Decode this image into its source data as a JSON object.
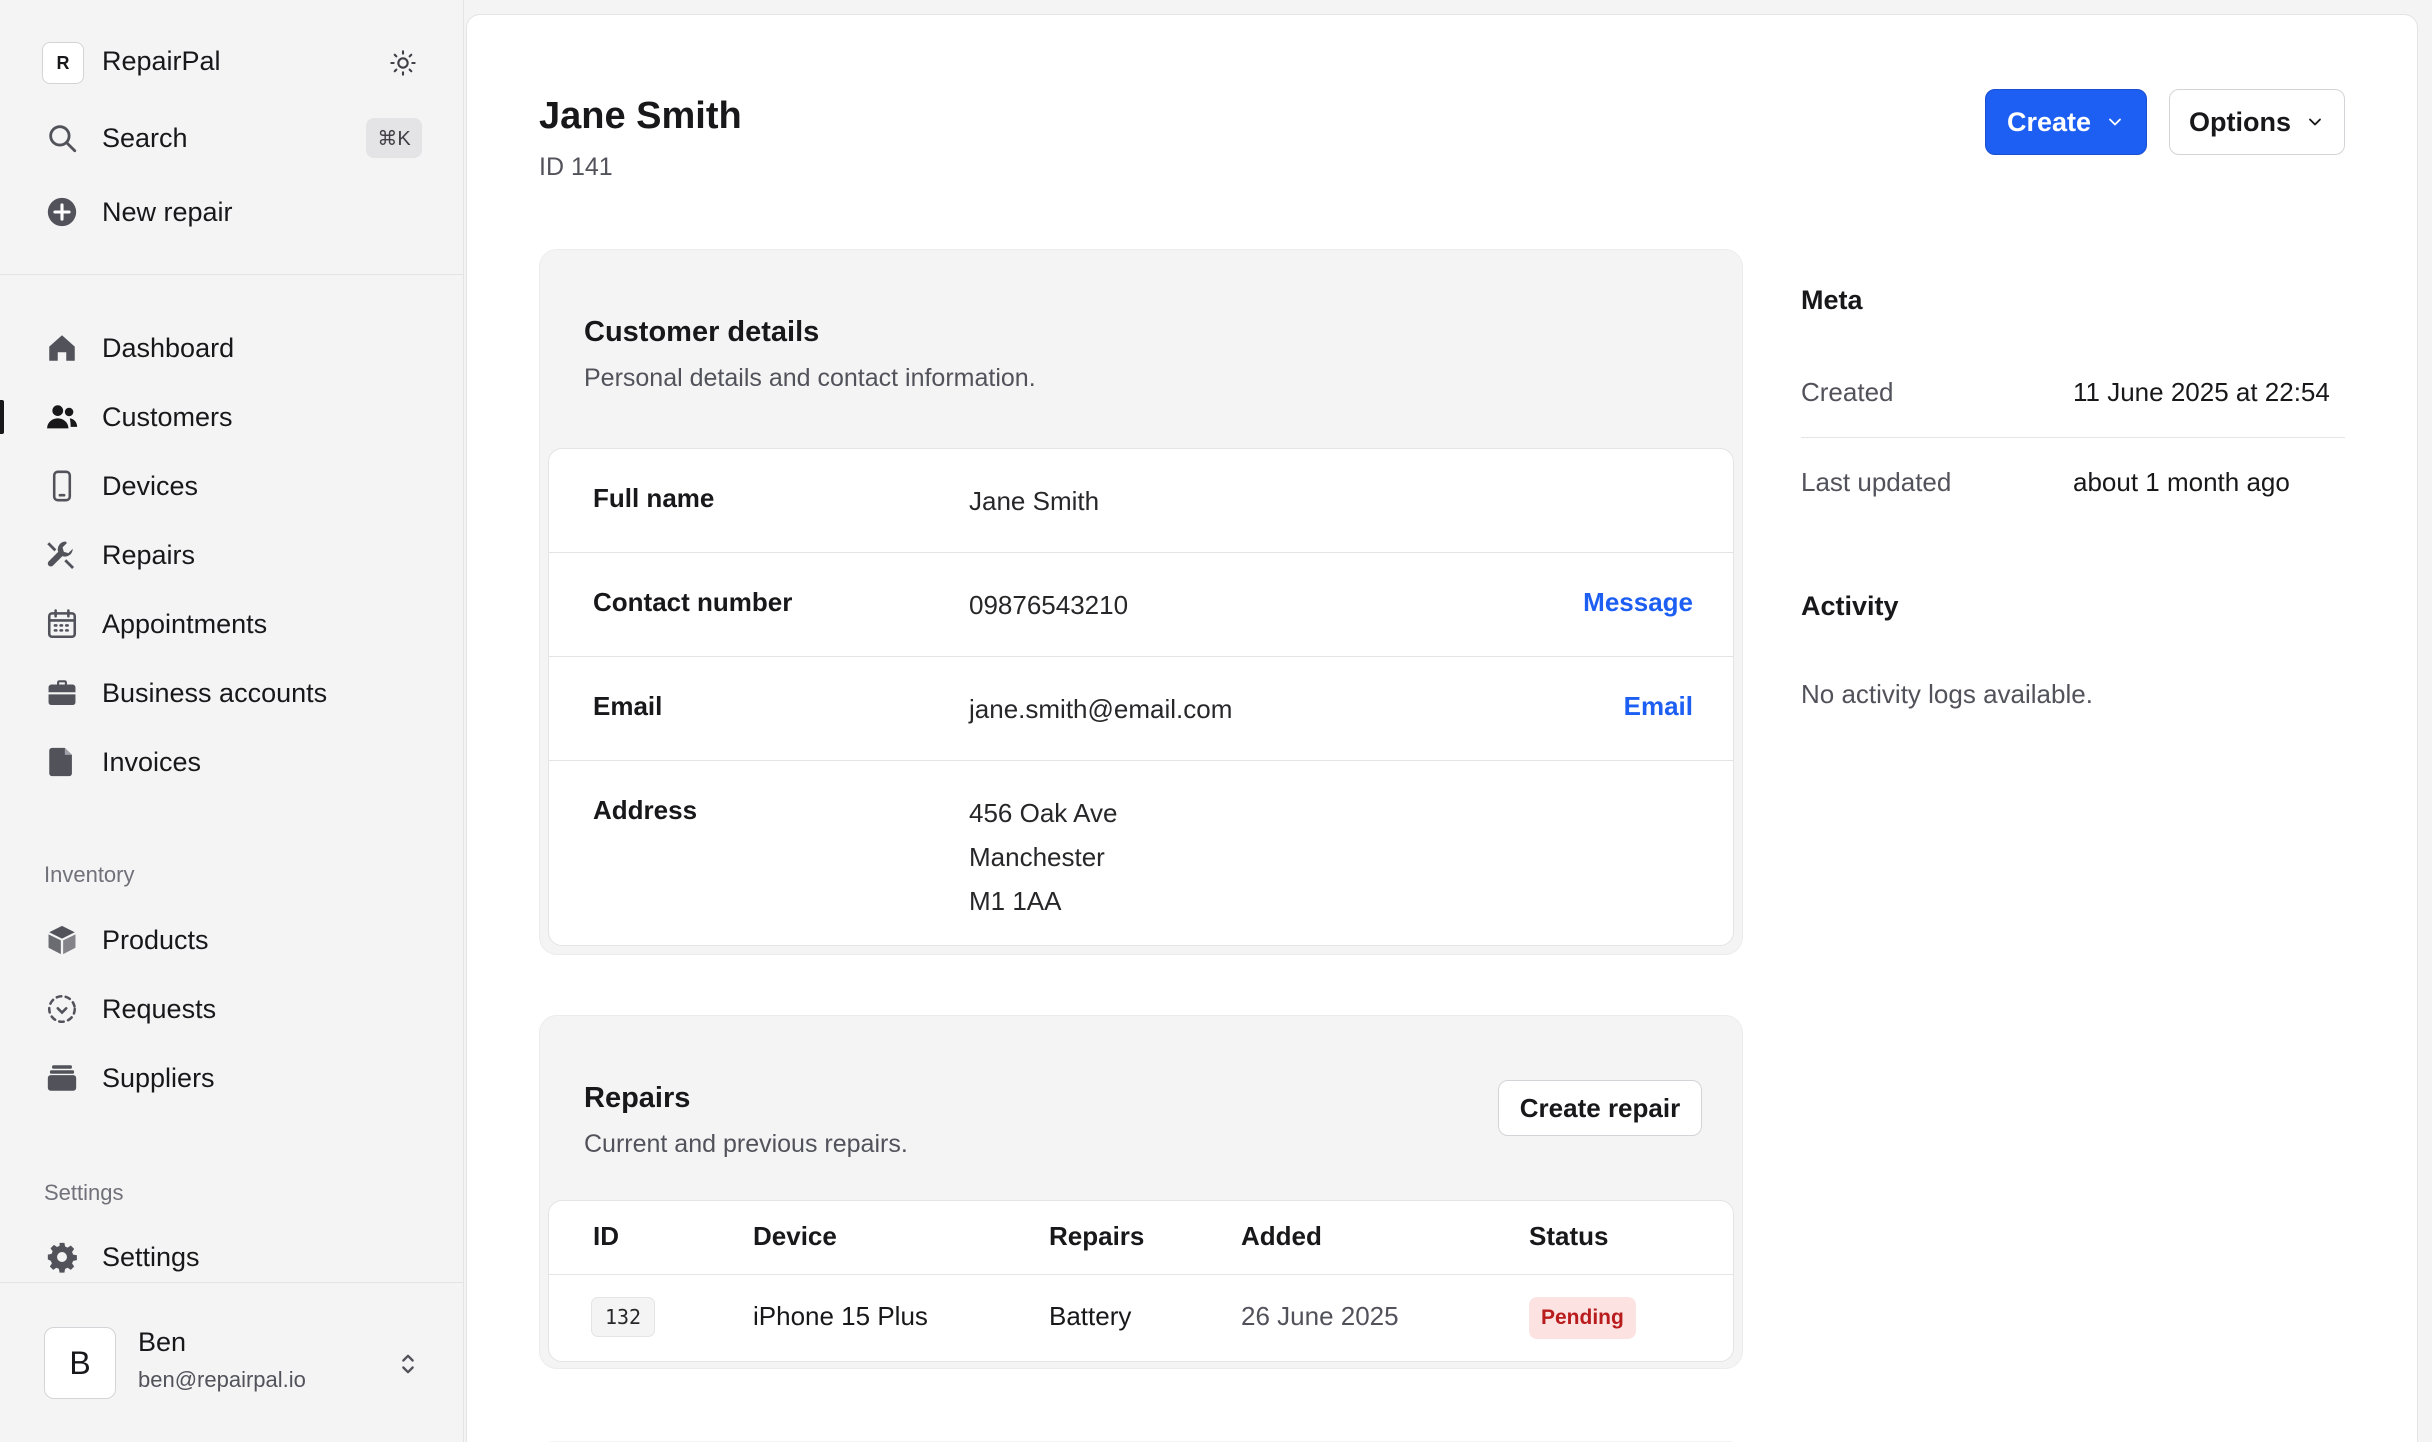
{
  "app": {
    "logo_letter": "R",
    "name": "RepairPal"
  },
  "sidebar": {
    "search_label": "Search",
    "search_shortcut": "⌘K",
    "new_repair_label": "New repair",
    "nav": [
      {
        "label": "Dashboard",
        "icon": "home-icon"
      },
      {
        "label": "Customers",
        "icon": "users-icon",
        "active": true
      },
      {
        "label": "Devices",
        "icon": "phone-icon"
      },
      {
        "label": "Repairs",
        "icon": "wrench-icon"
      },
      {
        "label": "Appointments",
        "icon": "calendar-icon"
      },
      {
        "label": "Business accounts",
        "icon": "briefcase-icon"
      },
      {
        "label": "Invoices",
        "icon": "document-icon"
      }
    ],
    "inventory_heading": "Inventory",
    "inventory": [
      {
        "label": "Products",
        "icon": "cube-icon"
      },
      {
        "label": "Requests",
        "icon": "dashed-circle-icon"
      },
      {
        "label": "Suppliers",
        "icon": "stack-icon"
      }
    ],
    "settings_heading": "Settings",
    "settings": [
      {
        "label": "Settings",
        "icon": "gear-icon"
      }
    ],
    "user": {
      "initial": "B",
      "name": "Ben",
      "email": "ben@repairpal.io"
    }
  },
  "header": {
    "title": "Jane Smith",
    "id_text": "ID 141",
    "create_label": "Create",
    "options_label": "Options"
  },
  "customer_details": {
    "title": "Customer details",
    "subtitle": "Personal details and contact information.",
    "rows": [
      {
        "key": "Full name",
        "value": "Jane Smith"
      },
      {
        "key": "Contact number",
        "value": "09876543210",
        "action": "Message"
      },
      {
        "key": "Email",
        "value": "jane.smith@email.com",
        "action": "Email"
      },
      {
        "key": "Address",
        "lines": [
          "456 Oak Ave",
          "Manchester",
          "M1 1AA"
        ]
      }
    ]
  },
  "repairs": {
    "title": "Repairs",
    "subtitle": "Current and previous repairs.",
    "create_label": "Create repair",
    "columns": [
      "ID",
      "Device",
      "Repairs",
      "Added",
      "Status"
    ],
    "rows": [
      {
        "id": "132",
        "device": "iPhone 15 Plus",
        "repairs": "Battery",
        "added": "26 June 2025",
        "status": "Pending"
      }
    ]
  },
  "meta": {
    "heading": "Meta",
    "created_label": "Created",
    "created_value": "11 June 2025 at 22:54",
    "updated_label": "Last updated",
    "updated_value": "about 1 month ago"
  },
  "activity": {
    "heading": "Activity",
    "empty_text": "No activity logs available."
  },
  "colors": {
    "accent": "#1d5ff2",
    "pending_bg": "#fde2e2",
    "pending_text": "#b91c1c"
  }
}
